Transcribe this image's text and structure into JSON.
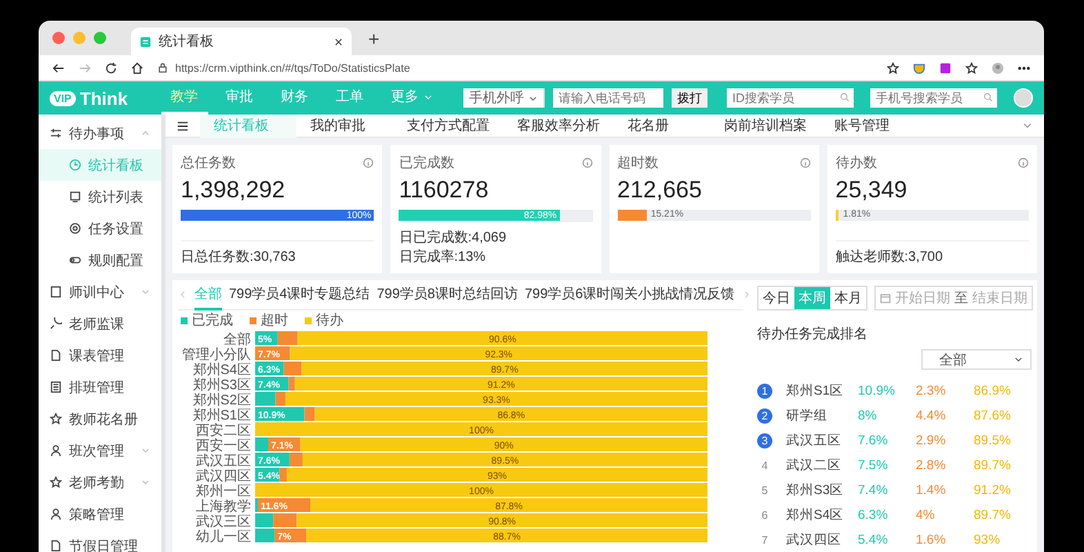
{
  "browser": {
    "tab_title": "统计看板",
    "new_tab": "+",
    "url": "https://crm.vipthink.cn/#/tqs/ToDo/StatisticsPlate"
  },
  "header": {
    "logo_badge": "VIP",
    "logo_text": "Think",
    "nav": [
      {
        "label": "教学",
        "selected": true
      },
      {
        "label": "审批",
        "selected": false
      },
      {
        "label": "财务",
        "selected": false
      },
      {
        "label": "工单",
        "selected": false
      },
      {
        "label": "更多",
        "selected": false
      }
    ],
    "call_select": "手机外呼",
    "phone_placeholder": "请输入电话号码",
    "call_button": "拨打",
    "id_search_placeholder": "ID搜索学员",
    "phone_search_placeholder": "手机号搜索学员"
  },
  "sidebar": {
    "items": [
      {
        "label": "待办事项",
        "expanded": true,
        "children": [
          {
            "label": "统计看板",
            "selected": true
          },
          {
            "label": "统计列表",
            "selected": false
          },
          {
            "label": "任务设置",
            "selected": false
          },
          {
            "label": "规则配置",
            "selected": false
          }
        ]
      },
      {
        "label": "师训中心",
        "expanded": false
      },
      {
        "label": "老师监课"
      },
      {
        "label": "课表管理"
      },
      {
        "label": "排班管理"
      },
      {
        "label": "教师花名册"
      },
      {
        "label": "班次管理",
        "expanded": false
      },
      {
        "label": "老师考勤",
        "expanded": false
      },
      {
        "label": "策略管理"
      },
      {
        "label": "节假日管理"
      }
    ]
  },
  "page_tabs": [
    {
      "label": "统计看板",
      "selected": true
    },
    {
      "label": "我的审批",
      "selected": false
    },
    {
      "label": "支付方式配置",
      "selected": false
    },
    {
      "label": "客服效率分析",
      "selected": false
    },
    {
      "label": "花名册",
      "selected": false
    },
    {
      "label": "岗前培训档案",
      "selected": false
    },
    {
      "label": "账号管理",
      "selected": false
    }
  ],
  "cards": [
    {
      "title": "总任务数",
      "value": "1,398,292",
      "level": 1,
      "bar_label": "100%",
      "color": "#2f6fe4",
      "footer": [
        "日总任务数:30,763"
      ]
    },
    {
      "title": "已完成数",
      "value": "1160278",
      "level": 0.8298,
      "bar_label": "82.98%",
      "color": "#1fd1b2",
      "footer": [
        "日已完成数:4,069",
        "日完成率:13%"
      ]
    },
    {
      "title": "超时数",
      "value": "212,665",
      "level": 0.1521,
      "bar_label": "15.21%",
      "color": "#f58a32"
    },
    {
      "title": "待办数",
      "value": "25,349",
      "level": 0.0181,
      "bar_label": "1.81%",
      "color": "#f5d22e",
      "footer": [
        "触达老师数:3,700"
      ]
    }
  ],
  "report": {
    "tabs": [
      {
        "label": "全部",
        "selected": true
      },
      {
        "label": "799学员4课时专题总结",
        "selected": false
      },
      {
        "label": "799学员8课时总结回访",
        "selected": false
      },
      {
        "label": "799学员6课时闯关小挑战情况反馈",
        "selected": false
      }
    ],
    "ranges": [
      {
        "label": "今日",
        "selected": false
      },
      {
        "label": "本周",
        "selected": true
      },
      {
        "label": "本月",
        "selected": false
      }
    ],
    "date_start_placeholder": "开始日期",
    "date_separator": "至",
    "date_end_placeholder": "结束日期",
    "chart_data": {
      "type": "bar",
      "orientation": "horizontal",
      "stacked": true,
      "categories": [
        "全部",
        "管理小分队",
        "郑州S4区",
        "郑州S3区",
        "郑州S2区",
        "郑州S1区",
        "西安二区",
        "西安一区",
        "武汉五区",
        "武汉四区",
        "郑州一区",
        "上海教学",
        "武汉三区",
        "幼儿一区"
      ],
      "series": [
        {
          "name": "已完成",
          "color": "#1fc9b0",
          "values": [
            5,
            0,
            6.3,
            7.4,
            4.5,
            10.9,
            0,
            2.9,
            7.6,
            5.4,
            0,
            0.6,
            4,
            4.3
          ],
          "value_labels": [
            "5%",
            null,
            "6.3%",
            "7.4%",
            null,
            "10.9%",
            null,
            null,
            "7.6%",
            "5.4%",
            null,
            null,
            null,
            null
          ]
        },
        {
          "name": "超时",
          "color": "#f58a32",
          "values": [
            4.4,
            7.7,
            4,
            1.4,
            2.2,
            2.3,
            0,
            7.1,
            2.9,
            1.6,
            0,
            11.6,
            5.2,
            7
          ],
          "value_labels": [
            null,
            "7.7%",
            null,
            null,
            null,
            null,
            null,
            "7.1%",
            null,
            null,
            null,
            "11.6%",
            null,
            "7%"
          ]
        },
        {
          "name": "待办",
          "color": "#f8c911",
          "values": [
            90.6,
            92.3,
            89.7,
            91.2,
            93.3,
            86.8,
            100,
            90,
            89.5,
            93,
            100,
            87.8,
            90.8,
            88.7
          ],
          "value_labels": [
            "90.6%",
            "92.3%",
            "89.7%",
            "91.2%",
            "93.3%",
            "86.8%",
            "100%",
            "90%",
            "89.5%",
            "93%",
            "100%",
            "87.8%",
            "90.8%",
            "88.7%"
          ]
        }
      ]
    }
  },
  "ranking": {
    "title": "待办任务完成排名",
    "filter": "全部",
    "rows": [
      {
        "rank": "1",
        "top": true,
        "name": "郑州S1区",
        "done": "10.9%",
        "overtime": "2.3%",
        "pending": "86.9%"
      },
      {
        "rank": "2",
        "top": true,
        "name": "研学组",
        "done": "8%",
        "overtime": "4.4%",
        "pending": "87.6%"
      },
      {
        "rank": "3",
        "top": true,
        "name": "武汉五区",
        "done": "7.6%",
        "overtime": "2.9%",
        "pending": "89.5%"
      },
      {
        "rank": "4",
        "top": false,
        "name": "武汉二区",
        "done": "7.5%",
        "overtime": "2.8%",
        "pending": "89.7%"
      },
      {
        "rank": "5",
        "top": false,
        "name": "郑州S3区",
        "done": "7.4%",
        "overtime": "1.4%",
        "pending": "91.2%"
      },
      {
        "rank": "6",
        "top": false,
        "name": "郑州S4区",
        "done": "6.3%",
        "overtime": "4%",
        "pending": "89.7%"
      },
      {
        "rank": "7",
        "top": false,
        "name": "武汉四区",
        "done": "5.4%",
        "overtime": "1.6%",
        "pending": "93%"
      }
    ]
  }
}
